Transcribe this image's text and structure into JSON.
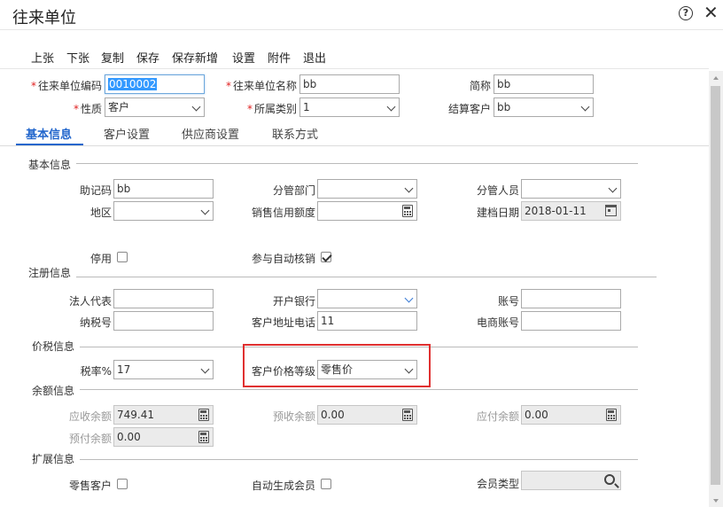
{
  "window": {
    "title": "往来单位",
    "help_glyph": "?",
    "close_glyph": "✕"
  },
  "toolbar": [
    "上张",
    "下张",
    "复制",
    "保存",
    "保存新增",
    "设置",
    "附件",
    "退出"
  ],
  "header": {
    "code_label": "往来单位编码",
    "code_value": "0010002",
    "name_label": "往来单位名称",
    "name_value": "bb",
    "short_label": "简称",
    "short_value": "bb",
    "nature_label": "性质",
    "nature_value": "客户",
    "category_label": "所属类别",
    "category_value": "1",
    "settle_label": "结算客户",
    "settle_value": "bb"
  },
  "tabs": [
    "基本信息",
    "客户设置",
    "供应商设置",
    "联系方式"
  ],
  "basic": {
    "section": "基本信息",
    "mnemonic_label": "助记码",
    "mnemonic_value": "bb",
    "dept_label": "分管部门",
    "dept_value": "",
    "staff_label": "分管人员",
    "staff_value": "",
    "region_label": "地区",
    "region_value": "",
    "credit_label": "销售信用额度",
    "credit_value": "",
    "created_label": "建档日期",
    "created_value": "2018-01-11",
    "disabled_label": "停用",
    "disabled_checked": false,
    "auto_writeoff_label": "参与自动核销",
    "auto_writeoff_checked": true
  },
  "registration": {
    "section": "注册信息",
    "legal_label": "法人代表",
    "legal_value": "",
    "bank_label": "开户银行",
    "bank_value": "",
    "account_label": "账号",
    "account_value": "",
    "taxno_label": "纳税号",
    "taxno_value": "",
    "addr_label": "客户地址电话",
    "addr_value": "11",
    "ecom_label": "电商账号",
    "ecom_value": ""
  },
  "tax": {
    "section": "价税信息",
    "rate_label": "税率%",
    "rate_value": "17",
    "price_level_label": "客户价格等级",
    "price_level_value": "零售价"
  },
  "balance": {
    "section": "余额信息",
    "receivable_label": "应收余额",
    "receivable_value": "749.41",
    "prereceived_label": "预收余额",
    "prereceived_value": "0.00",
    "payable_label": "应付余额",
    "payable_value": "0.00",
    "prepaid_label": "预付余额",
    "prepaid_value": "0.00"
  },
  "extension": {
    "section": "扩展信息",
    "retail_label": "零售客户",
    "retail_checked": false,
    "auto_member_label": "自动生成会员",
    "auto_member_checked": false,
    "member_type_label": "会员类型",
    "member_type_value": ""
  },
  "colors": {
    "accent": "#2266cc",
    "required": "#e02020",
    "highlight_box": "#e03030"
  }
}
